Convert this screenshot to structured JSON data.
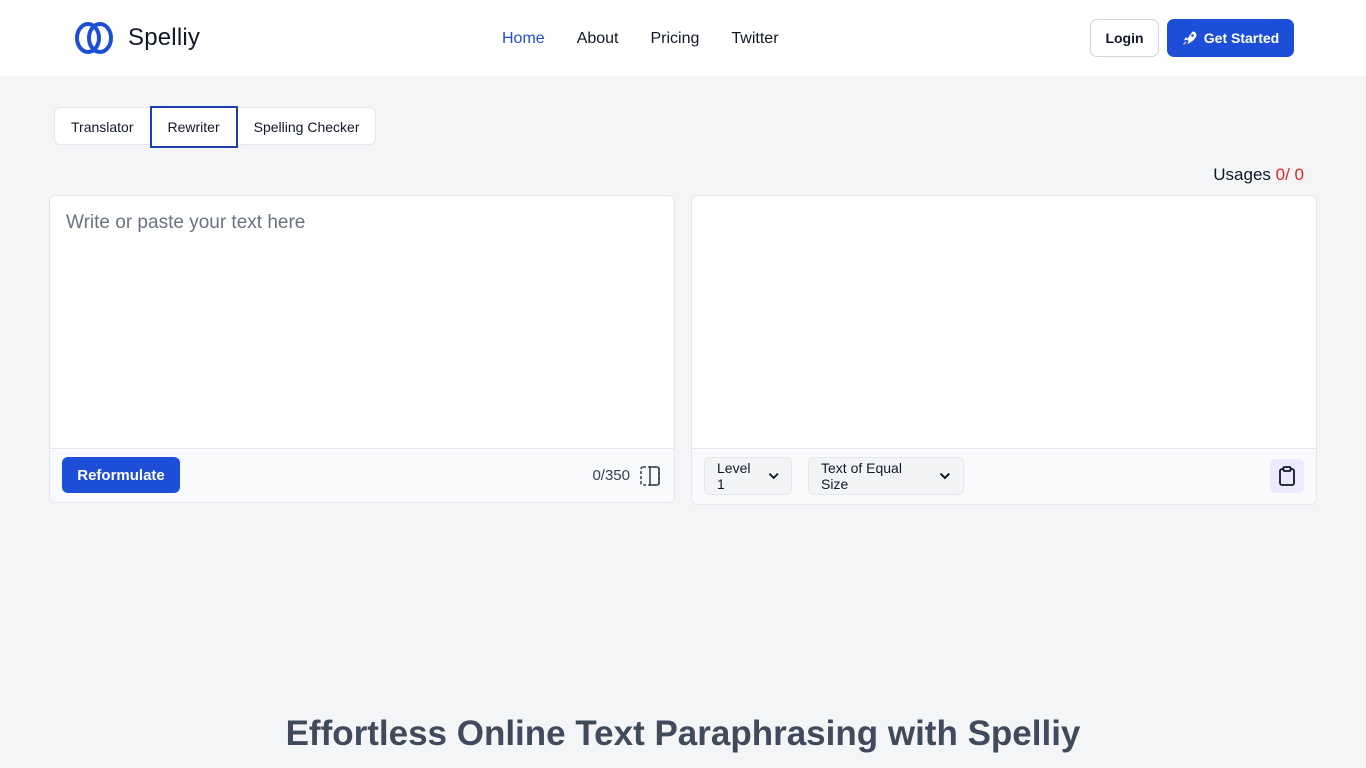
{
  "brand": {
    "name": "Spelliy",
    "icon": "logo-loops-icon",
    "color": "#1d4ed8"
  },
  "nav": {
    "items": [
      {
        "label": "Home",
        "active": true
      },
      {
        "label": "About",
        "active": false
      },
      {
        "label": "Pricing",
        "active": false
      },
      {
        "label": "Twitter",
        "active": false
      }
    ]
  },
  "header": {
    "login_label": "Login",
    "get_started_label": "Get Started",
    "get_started_icon": "rocket-icon"
  },
  "tabs": [
    {
      "label": "Translator",
      "selected": false
    },
    {
      "label": "Rewriter",
      "selected": true
    },
    {
      "label": "Spelling Checker",
      "selected": false
    }
  ],
  "usages": {
    "label": "Usages",
    "count": "0/ 0"
  },
  "input_panel": {
    "placeholder": "Write or paste your text here",
    "value": "",
    "reformulate_label": "Reformulate",
    "char_count": "0/350",
    "split_icon": "split-view-icon"
  },
  "output_panel": {
    "level_select": "Level 1",
    "size_select": "Text of Equal Size",
    "copy_icon": "clipboard-icon"
  },
  "hero": {
    "title": "Effortless Online Text Paraphrasing with Spelliy"
  },
  "colors": {
    "accent": "#1d4ed8",
    "usage_count": "#dc2626",
    "page_bg": "#f4f5f7"
  }
}
